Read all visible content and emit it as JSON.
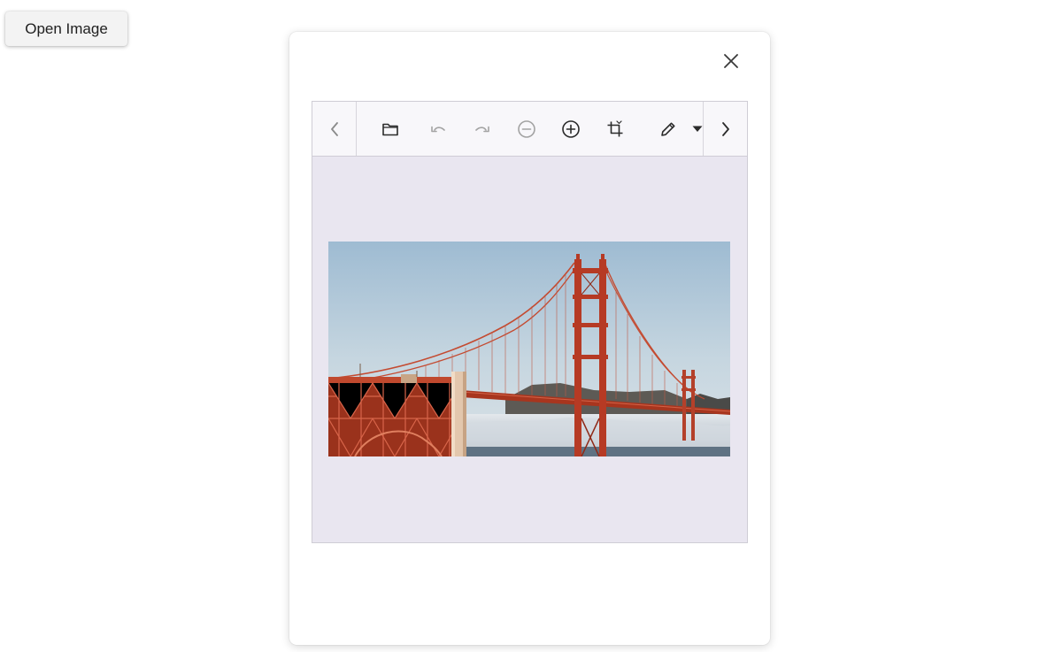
{
  "open_button": {
    "label": "Open Image"
  },
  "dialog": {
    "close_icon": "close-icon",
    "toolbar": {
      "prev_icon": "chevron-left-icon",
      "next_icon": "chevron-right-icon",
      "tools": [
        {
          "name": "open-folder-icon",
          "enabled": true
        },
        {
          "name": "undo-icon",
          "enabled": false
        },
        {
          "name": "redo-icon",
          "enabled": false
        },
        {
          "name": "zoom-out-icon",
          "enabled": false
        },
        {
          "name": "zoom-in-icon",
          "enabled": true
        },
        {
          "name": "crop-icon",
          "enabled": true
        },
        {
          "name": "pen-icon",
          "enabled": true
        },
        {
          "name": "dropdown-caret-icon",
          "enabled": true
        }
      ]
    },
    "image": {
      "subject": "golden-gate-bridge"
    }
  },
  "colors": {
    "toolbar_bg": "#f8f7fa",
    "canvas_bg": "#e9e6f0",
    "icon_active": "#2b2b2b",
    "icon_disabled": "#a3a3a3",
    "bridge_red": "#b63a24"
  }
}
